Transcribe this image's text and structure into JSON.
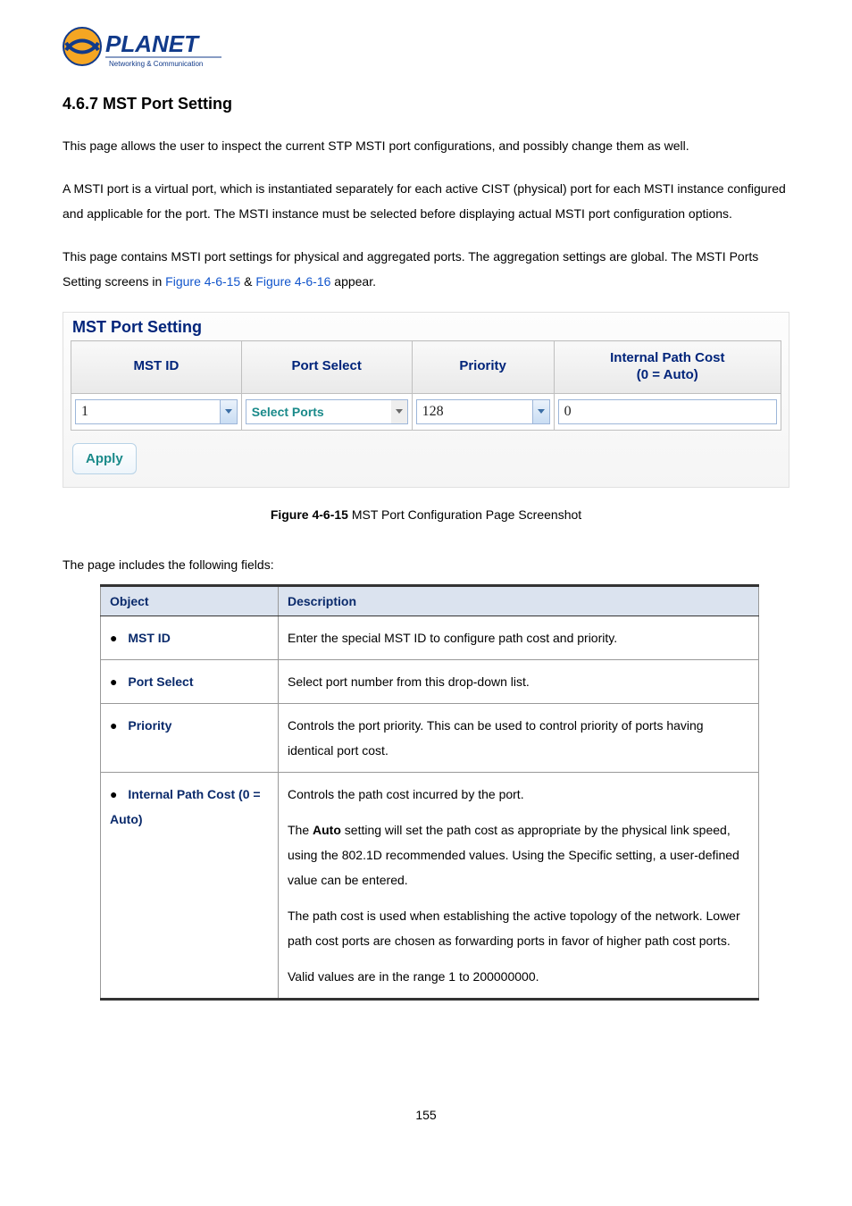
{
  "logo": {
    "brand": "PLANET",
    "tagline": "Networking & Communication"
  },
  "heading": "4.6.7 MST Port Setting",
  "para1": "This page allows the user to inspect the current STP MSTI port configurations, and possibly change them as well.",
  "para2": "A MSTI port is a virtual port, which is instantiated separately for each active CIST (physical) port for each MSTI instance configured and applicable for the port. The MSTI instance must be selected before displaying actual MSTI port configuration options.",
  "para3_a": "This page contains MSTI port settings for physical and aggregated ports. The aggregation settings are global. The MSTI Ports Setting screens in ",
  "para3_link1": "Figure 4-6-15",
  "para3_mid": " & ",
  "para3_link2": "Figure 4-6-16",
  "para3_b": " appear.",
  "panel": {
    "title": "MST Port Setting",
    "hdr_mst_id": "MST ID",
    "hdr_port_select": "Port Select",
    "hdr_priority": "Priority",
    "hdr_path_cost_l1": "Internal Path Cost",
    "hdr_path_cost_l2": "(0 = Auto)",
    "val_mst_id": "1",
    "val_port_select": "Select Ports",
    "val_priority": "128",
    "val_path_cost": "0",
    "apply": "Apply"
  },
  "caption": {
    "bold": "Figure 4-6-15",
    "rest": " MST Port Configuration Page Screenshot"
  },
  "fields_intro": "The page includes the following fields:",
  "table": {
    "hdr_object": "Object",
    "hdr_desc": "Description",
    "rows": [
      {
        "obj": "MST ID",
        "desc": [
          "Enter the special MST ID to configure path cost and priority."
        ]
      },
      {
        "obj": "Port Select",
        "desc": [
          "Select port number from this drop-down list."
        ]
      },
      {
        "obj": "Priority",
        "desc": [
          "Controls the port priority. This can be used to control priority of ports having identical port cost."
        ]
      },
      {
        "obj": "Internal Path Cost (0 = Auto)",
        "desc": [
          "Controls the path cost incurred by the port.",
          "The <b>Auto</b> setting will set the path cost as appropriate by the physical link speed, using the 802.1D recommended values. Using the Specific setting, a user-defined value can be entered.",
          "The path cost is used when establishing the active topology of the network. Lower path cost ports are chosen as forwarding ports in favor of higher path cost ports.",
          "Valid values are in the range 1 to 200000000."
        ]
      }
    ]
  },
  "page_number": "155"
}
